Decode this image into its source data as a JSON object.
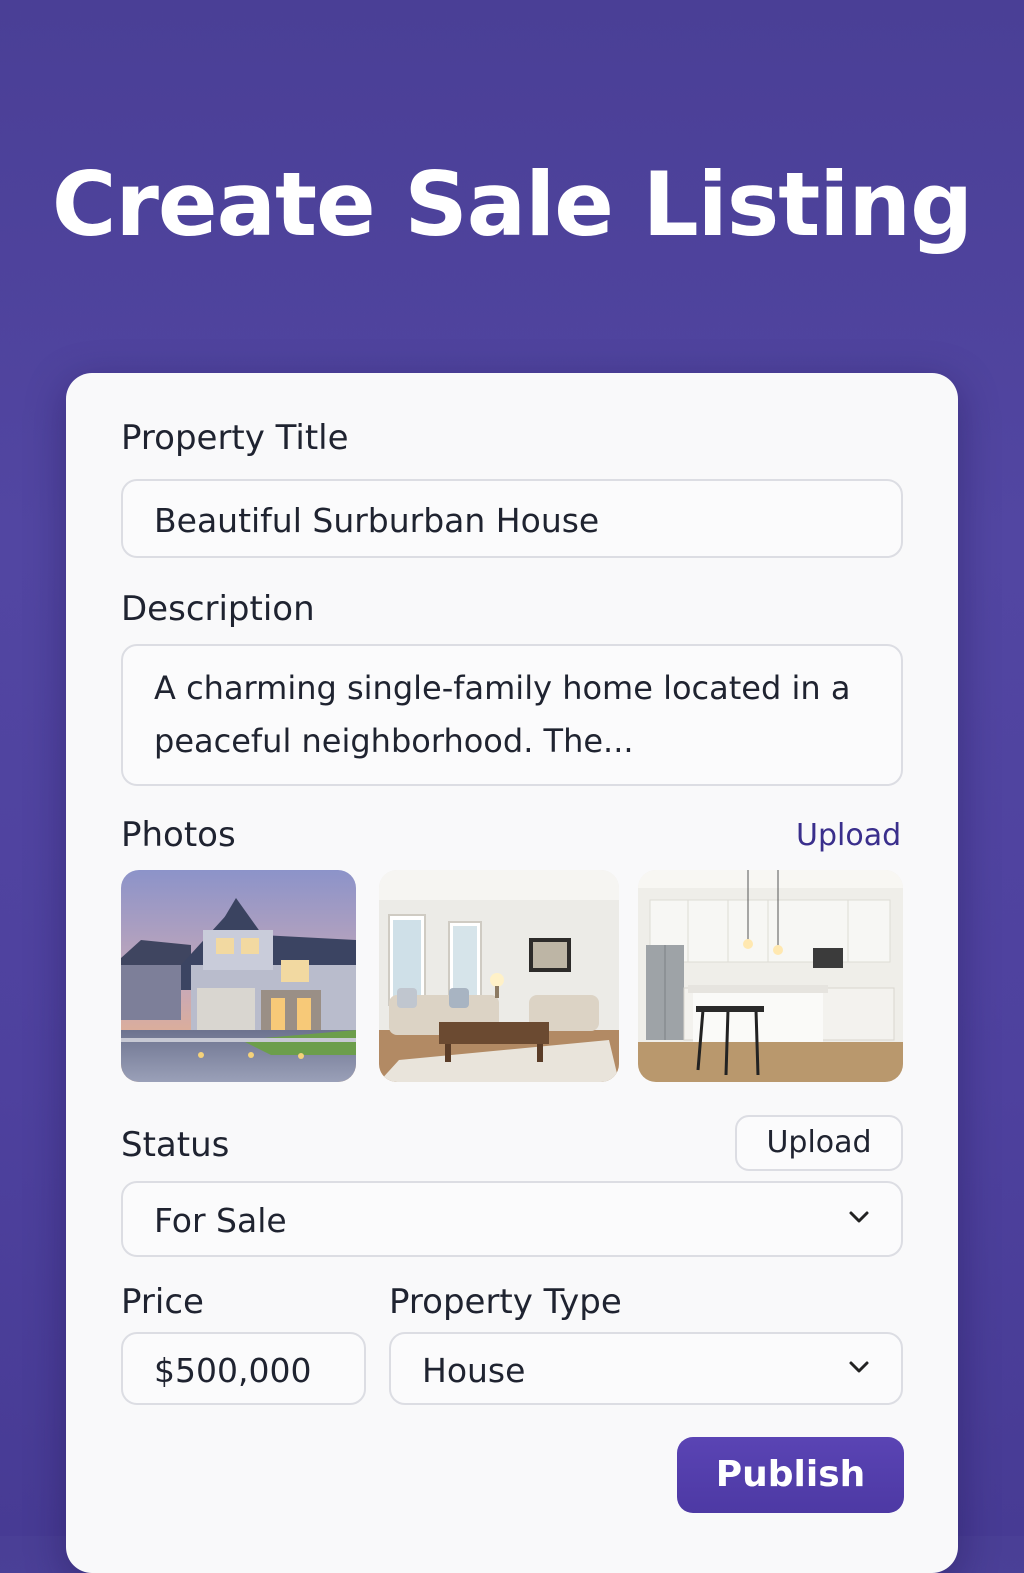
{
  "header": {
    "title": "Create Sale Listing"
  },
  "form": {
    "property_title": {
      "label": "Property Title",
      "value": "Beautiful Surburban House"
    },
    "description": {
      "label": "Description",
      "value": "A charming single-family home located in a peaceful neighborhood. The..."
    },
    "photos": {
      "label": "Photos",
      "upload_link": "Upload",
      "items": [
        {
          "subject": "house-exterior"
        },
        {
          "subject": "living-room"
        },
        {
          "subject": "kitchen"
        }
      ]
    },
    "status": {
      "label": "Status",
      "upload_button": "Upload",
      "selected": "For Sale",
      "icon": "chevron-down-icon"
    },
    "price": {
      "label": "Price",
      "value": "$500,000"
    },
    "property_type": {
      "label": "Property Type",
      "selected": "House",
      "icon": "chevron-down-icon"
    },
    "publish_label": "Publish"
  },
  "colors": {
    "background": "#4e419e",
    "accent": "#4d39a4",
    "link": "#3a2f8c",
    "card": "#f9f9fa"
  }
}
